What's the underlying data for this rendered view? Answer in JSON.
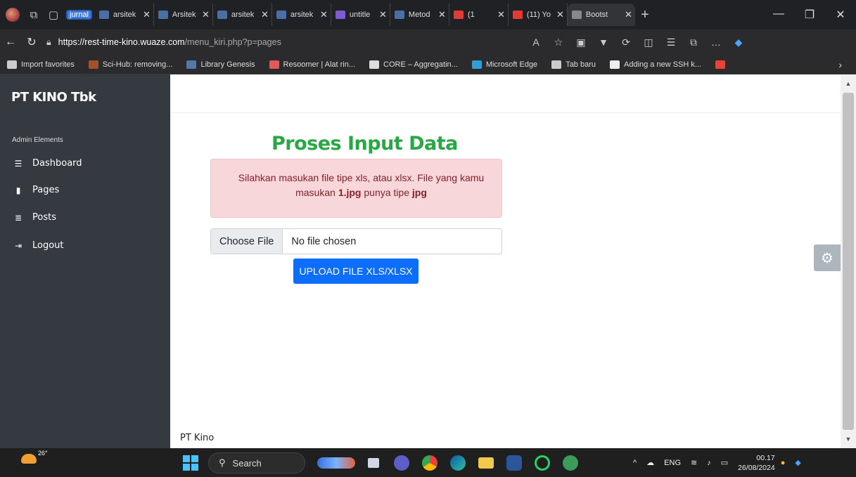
{
  "browser": {
    "group_label": "jurnal",
    "tabs": [
      {
        "label": "arsitek",
        "color": "#4a6fa5"
      },
      {
        "label": "Arsitek",
        "color": "#4a6fa5"
      },
      {
        "label": "arsitek",
        "color": "#4a6fa5"
      },
      {
        "label": "arsitek",
        "color": "#4a6fa5"
      },
      {
        "label": "untitle",
        "color": "#7b5cd6"
      },
      {
        "label": "Metod",
        "color": "#4a6fa5"
      },
      {
        "label": "(1",
        "color": "#e53935"
      },
      {
        "label": "(11) Yo",
        "color": "#e53935"
      },
      {
        "label": "Bootst",
        "color": "#888888"
      }
    ],
    "url_domain": "https://rest-time-kino.wuaze.com",
    "url_path": "/menu_kiri.php?p=pages",
    "bookmarks": [
      {
        "label": "Import favorites",
        "color": "#cccccc"
      },
      {
        "label": "Sci-Hub: removing...",
        "color": "#a0522d"
      },
      {
        "label": "Library Genesis",
        "color": "#5577aa"
      },
      {
        "label": "Resoomer | Alat rin...",
        "color": "#e05a5a"
      },
      {
        "label": "CORE – Aggregatin...",
        "color": "#dddddd"
      },
      {
        "label": "Microsoft Edge",
        "color": "#2f9fd8"
      },
      {
        "label": "Tab baru",
        "color": "#cccccc"
      },
      {
        "label": "Adding a new SSH k...",
        "color": "#eeeeee"
      },
      {
        "label": "",
        "color": "#ea4335"
      }
    ]
  },
  "sidebar": {
    "brand": "PT KINO Tbk",
    "section": "Admin Elements",
    "items": [
      {
        "label": "Dashboard",
        "icon": "list-icon"
      },
      {
        "label": "Pages",
        "icon": "file-icon"
      },
      {
        "label": "Posts",
        "icon": "sliders-icon"
      },
      {
        "label": "Logout",
        "icon": "sign-out-icon"
      }
    ]
  },
  "main": {
    "title": "Proses Input Data",
    "alert_pre": "Silahkan masukan file tipe xls, atau xlsx. File yang kamu masukan ",
    "alert_file": "1.jpg",
    "alert_mid": " punya tipe ",
    "alert_type": "jpg",
    "choose_file": "Choose File",
    "no_file": "No file chosen",
    "upload_button": "UPLOAD FILE XLS/XLSX",
    "footer": "PT Kino"
  },
  "taskbar": {
    "temperature": "26°",
    "search": "Search",
    "language": "ENG",
    "time": "00.17",
    "date": "26/08/2024"
  }
}
